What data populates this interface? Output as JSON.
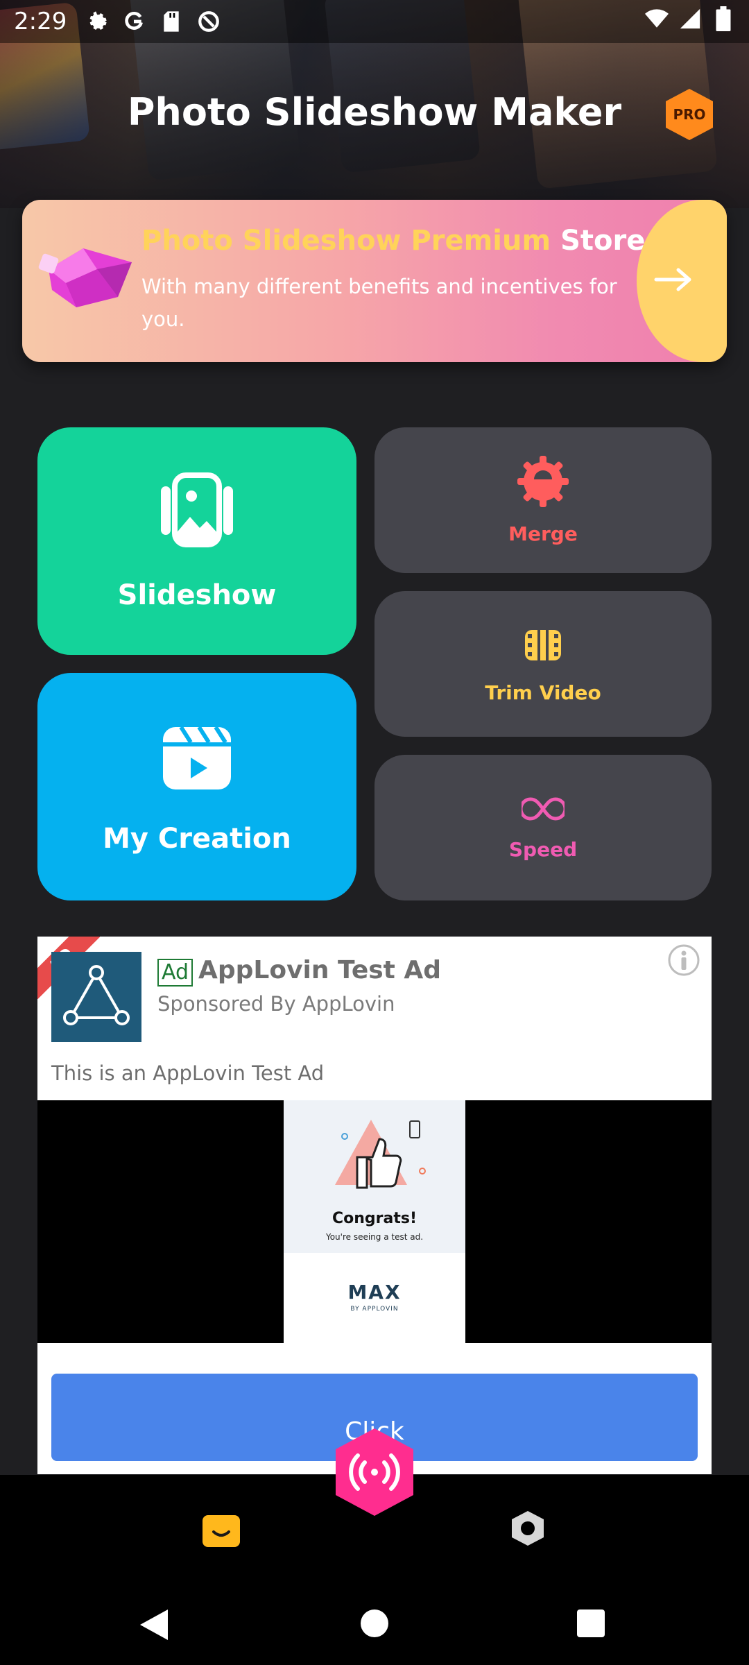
{
  "status_bar": {
    "time": "2:29",
    "left_icons": [
      "gear-icon",
      "google-icon",
      "sd-card-icon",
      "data-saver-icon"
    ],
    "right_icons": [
      "wifi-icon",
      "signal-icon",
      "battery-icon"
    ]
  },
  "header": {
    "title": "Photo Slideshow Maker",
    "pro_badge": "PRO"
  },
  "premium_banner": {
    "title_highlight": "Photo Slideshow Premium",
    "title_rest": "Store",
    "description": "With many different benefits and incentives for you.",
    "icon": "gem-icon",
    "arrow_icon": "arrow-right-icon"
  },
  "tiles": {
    "slideshow": {
      "label": "Slideshow",
      "icon": "photo-gallery-icon"
    },
    "my_creation": {
      "label": "My Creation",
      "icon": "clapperboard-play-icon"
    },
    "merge": {
      "label": "Merge",
      "icon": "merge-gear-icon"
    },
    "trim_video": {
      "label": "Trim Video",
      "icon": "film-trim-icon"
    },
    "speed": {
      "label": "Speed",
      "icon": "infinity-icon"
    }
  },
  "ad": {
    "corner_label": "AD",
    "tag": "Ad",
    "title": "AppLovin Test Ad",
    "sponsor": "Sponsored By AppLovin",
    "body": "This is an AppLovin Test Ad",
    "creative_headline": "Congrats!",
    "creative_sub": "You're seeing a test ad.",
    "creative_brand": "MAX",
    "creative_brand_sub": "BY APPLOVIN",
    "cta": "Click"
  },
  "bottom_nav": {
    "items": [
      "home-icon",
      "settings-icon"
    ],
    "fab_icon": "broadcast-icon"
  },
  "colors": {
    "slideshow": "#14d39a",
    "my_creation": "#05b1ef",
    "merge": "#ff5d5d",
    "trim_video": "#ffcf4d",
    "speed": "#f05bb2",
    "fab": "#ff2d8f",
    "cta": "#4a84ea"
  }
}
